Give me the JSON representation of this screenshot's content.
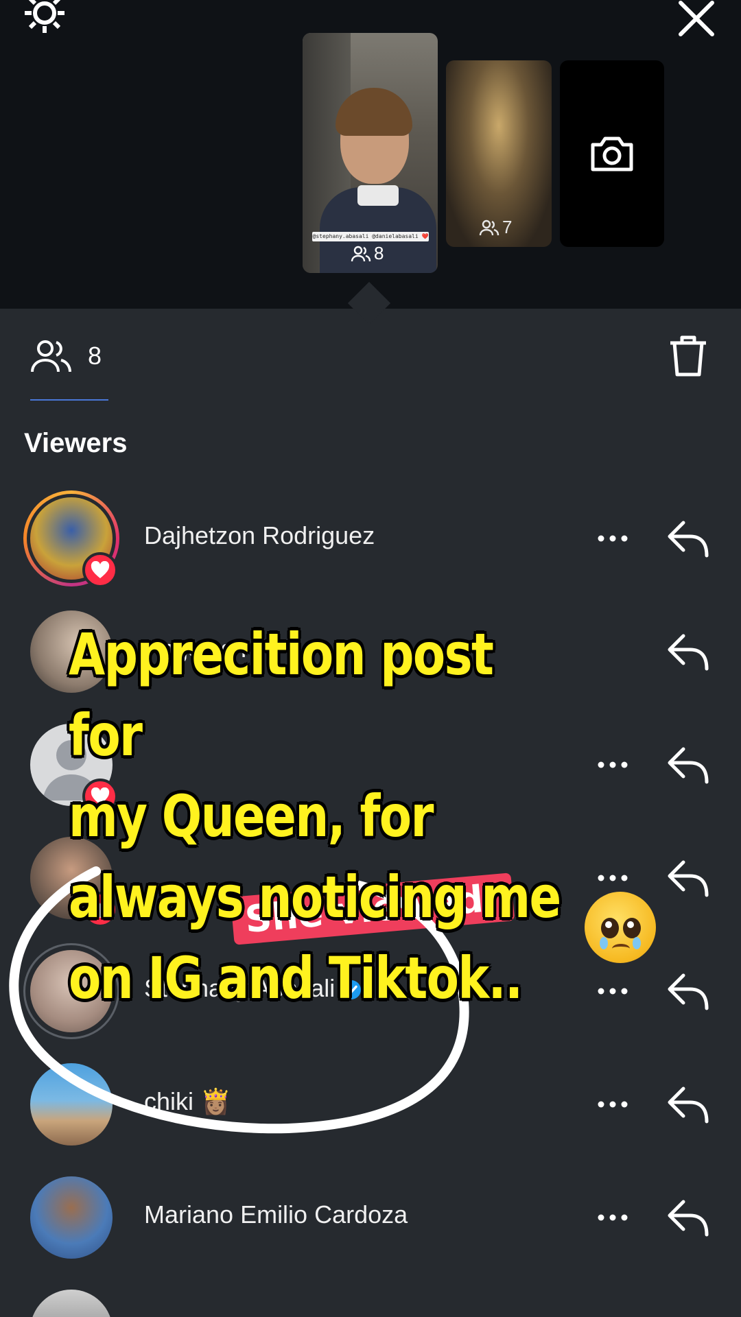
{
  "stories": [
    {
      "mention_text": "@stephany.abasali @danielabasali ❤️",
      "viewer_count": "8"
    },
    {
      "viewer_count": "7"
    },
    {
      "icon": "camera-icon"
    }
  ],
  "tab": {
    "viewer_count": "8"
  },
  "section_title": "Viewers",
  "viewers": [
    {
      "name": "Dajhetzon Rodriguez",
      "liked": true,
      "story_ring": true,
      "verified": false
    },
    {
      "name": "Angeles I",
      "liked": false,
      "story_ring": false,
      "verified": false
    },
    {
      "name": "",
      "liked": true,
      "story_ring": false,
      "verified": false
    },
    {
      "name": "",
      "liked": true,
      "story_ring": false,
      "verified": false
    },
    {
      "name": "Stephany Abasali",
      "liked": false,
      "story_ring": false,
      "verified": true
    },
    {
      "name": "chiki 👸🏽",
      "liked": false,
      "story_ring": false,
      "verified": false
    },
    {
      "name": "Mariano Emilio Cardoza",
      "liked": false,
      "story_ring": false,
      "verified": false
    },
    {
      "name": "",
      "liked": false,
      "story_ring": false,
      "verified": false
    }
  ],
  "overlay": {
    "caption": "Apprecition post for\nmy Queen, for\nalways noticing me\non IG and Tiktok..",
    "emoji": "pleading-face-with-tears",
    "sticker_text": "She viewed! 😱"
  },
  "colors": {
    "caption_yellow": "#fff21f",
    "heart_red": "#ff2d46",
    "verified_blue": "#1d9bf0",
    "tab_underline": "#4a78d8"
  }
}
